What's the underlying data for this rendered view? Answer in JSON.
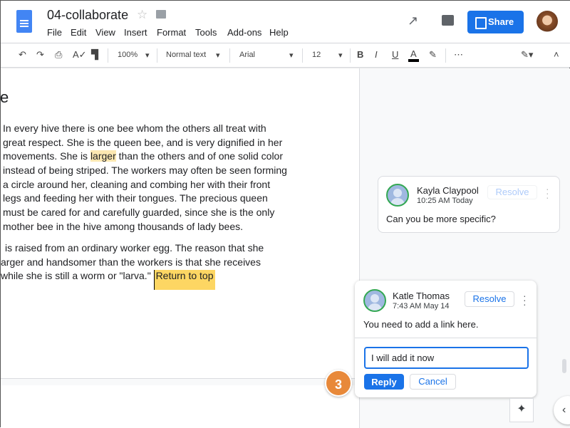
{
  "header": {
    "title": "04-collaborate",
    "menu": [
      "File",
      "Edit",
      "View",
      "Insert",
      "Format",
      "Tools",
      "Add-ons",
      "Help"
    ],
    "share_label": "Share",
    "accent": "#1a73e8"
  },
  "toolbar": {
    "zoom": "100%",
    "style": "Normal text",
    "font": "Arial",
    "size": "12",
    "bold": "B",
    "italic": "I",
    "underline": "U",
    "text_color": "A",
    "more": "⋯"
  },
  "document": {
    "heading": "e",
    "lines": [
      {
        "pre": "In every hive there is one bee whom the others all treat with",
        "hl": "",
        "post": ""
      },
      {
        "pre": "great respect. She is the queen bee, and is very dignified in her",
        "hl": "",
        "post": ""
      },
      {
        "pre": "movements. She is ",
        "hl": "larger",
        "post": " than the others and of one solid color"
      },
      {
        "pre": "instead of being striped. The workers may often be seen forming",
        "hl": "",
        "post": ""
      },
      {
        "pre": "a circle around her, cleaning and combing her with their front",
        "hl": "",
        "post": ""
      },
      {
        "pre": "legs and feeding her with their tongues. The precious queen",
        "hl": "",
        "post": ""
      },
      {
        "pre": "must be cared for and carefully guarded, since she is the only",
        "hl": "",
        "post": ""
      },
      {
        "pre": "mother bee in the hive among thousands of lady bees.",
        "hl": "",
        "post": ""
      },
      {
        "pre": "is raised from an ordinary worker egg. The reason that she",
        "hl": "",
        "post": ""
      },
      {
        "pre": "arger and handsomer than the workers is that she receives",
        "hl": "",
        "post": ""
      },
      {
        "pre": "while she is still a worm or \"larva.\" ",
        "hl": "Return to top",
        "post": ""
      }
    ]
  },
  "comments": [
    {
      "author": "Kayla Claypool",
      "time": "10:25 AM Today",
      "text": "Can you be more specific?",
      "resolve": "Resolve"
    },
    {
      "author": "Katle Thomas",
      "time": "7:43 AM May 14",
      "text": "You need to add a link here.",
      "resolve": "Resolve",
      "reply_value": "I will add it now",
      "reply_label": "Reply",
      "cancel_label": "Cancel"
    }
  ],
  "step_badge": "3"
}
